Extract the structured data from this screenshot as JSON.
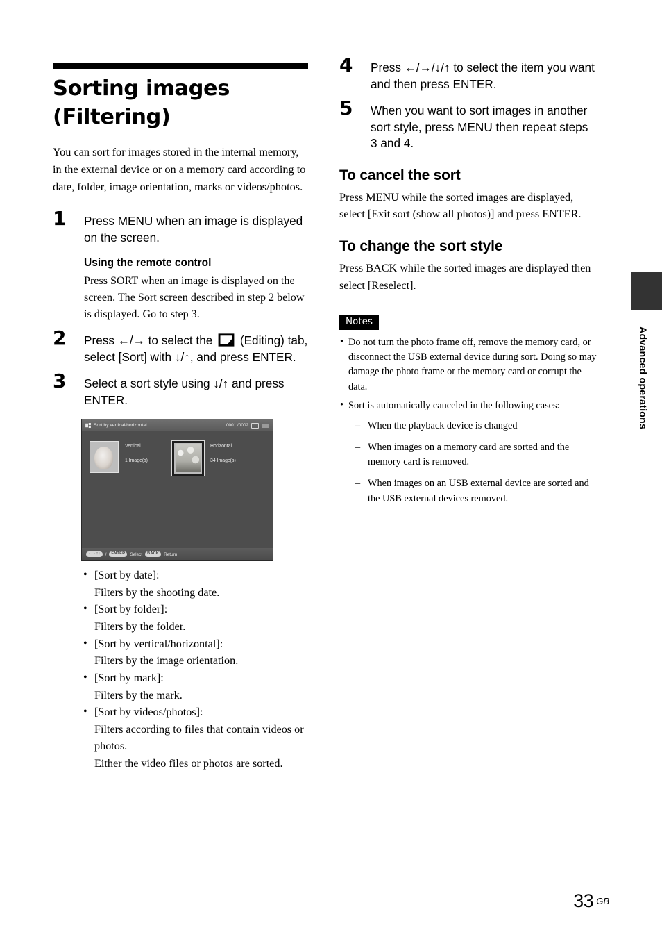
{
  "document": {
    "page_number": "33",
    "page_region_code": "GB",
    "side_tab_label": "Advanced operations"
  },
  "left_column": {
    "title_line1": "Sorting images",
    "title_line2": "(Filtering)",
    "intro": "You can sort for images stored in the internal memory, in the external device or on a memory card according to date, folder, image orientation, marks or videos/photos.",
    "steps": [
      {
        "number": "1",
        "text": "Press MENU when an image is displayed on the screen."
      },
      {
        "number": "2",
        "text_before_icon": "Press ←/→ to select the ",
        "icon_name": "editing-tab-icon",
        "text_after_icon": " (Editing) tab, select [Sort] with ↓/↑, and press ENTER."
      },
      {
        "number": "3",
        "text": "Select a sort style using ↓/↑ and press ENTER."
      }
    ],
    "remote_control": {
      "heading": "Using the remote control",
      "body": "Press SORT when an image is displayed on the screen. The Sort screen described in step 2 below is displayed. Go to step 3."
    },
    "device_screenshot": {
      "header_title": "Sort by vertical/horizontal",
      "header_counter": "0001 /0002",
      "header_icons": [
        "memory-card-icon",
        "battery-icon"
      ],
      "items": [
        {
          "label": "Vertical",
          "count": "1 Image(s)",
          "selected": false
        },
        {
          "label": "Horizontal",
          "count": "34 Image(s)",
          "selected": true
        }
      ],
      "footer": {
        "dpad_key": "←→↑↓",
        "separator": "/",
        "enter_key": "ENTER",
        "enter_action": "Select",
        "back_key": "BACK",
        "back_action": "Return"
      }
    },
    "sort_styles": [
      {
        "name": "[Sort by date]:",
        "desc": "Filters by the shooting date."
      },
      {
        "name": "[Sort by folder]:",
        "desc": "Filters by the folder."
      },
      {
        "name": "[Sort by vertical/horizontal]:",
        "desc": "Filters by the image orientation."
      },
      {
        "name": "[Sort by mark]:",
        "desc": "Filters by the mark."
      },
      {
        "name": "[Sort by videos/photos]:",
        "desc": "Filters according to files that contain videos or photos.",
        "desc2": "Either the video files or photos are sorted."
      }
    ]
  },
  "right_column": {
    "steps": [
      {
        "number": "4",
        "text": "Press ←/→/↓/↑ to select the item you want and then press ENTER."
      },
      {
        "number": "5",
        "text": "When you want to sort images in another sort style, press MENU then repeat steps 3 and 4."
      }
    ],
    "cancel_section": {
      "heading": "To cancel the sort",
      "body": "Press MENU while the sorted images are displayed, select [Exit sort (show all photos)] and press ENTER."
    },
    "change_section": {
      "heading": "To change the sort style",
      "body": "Press BACK while the sorted images are displayed then select [Reselect]."
    },
    "notes": {
      "label": "Notes",
      "items": [
        "Do not turn the photo frame off, remove the memory card, or disconnect the USB external device during sort. Doing so may damage the photo frame or the memory card or corrupt the data.",
        "Sort is automatically canceled in the following cases:"
      ],
      "sub_items": [
        "When the playback device is changed",
        "When images on a memory card are sorted and the memory card is removed.",
        "When images on an USB external device are sorted and the USB external devices removed."
      ]
    }
  }
}
